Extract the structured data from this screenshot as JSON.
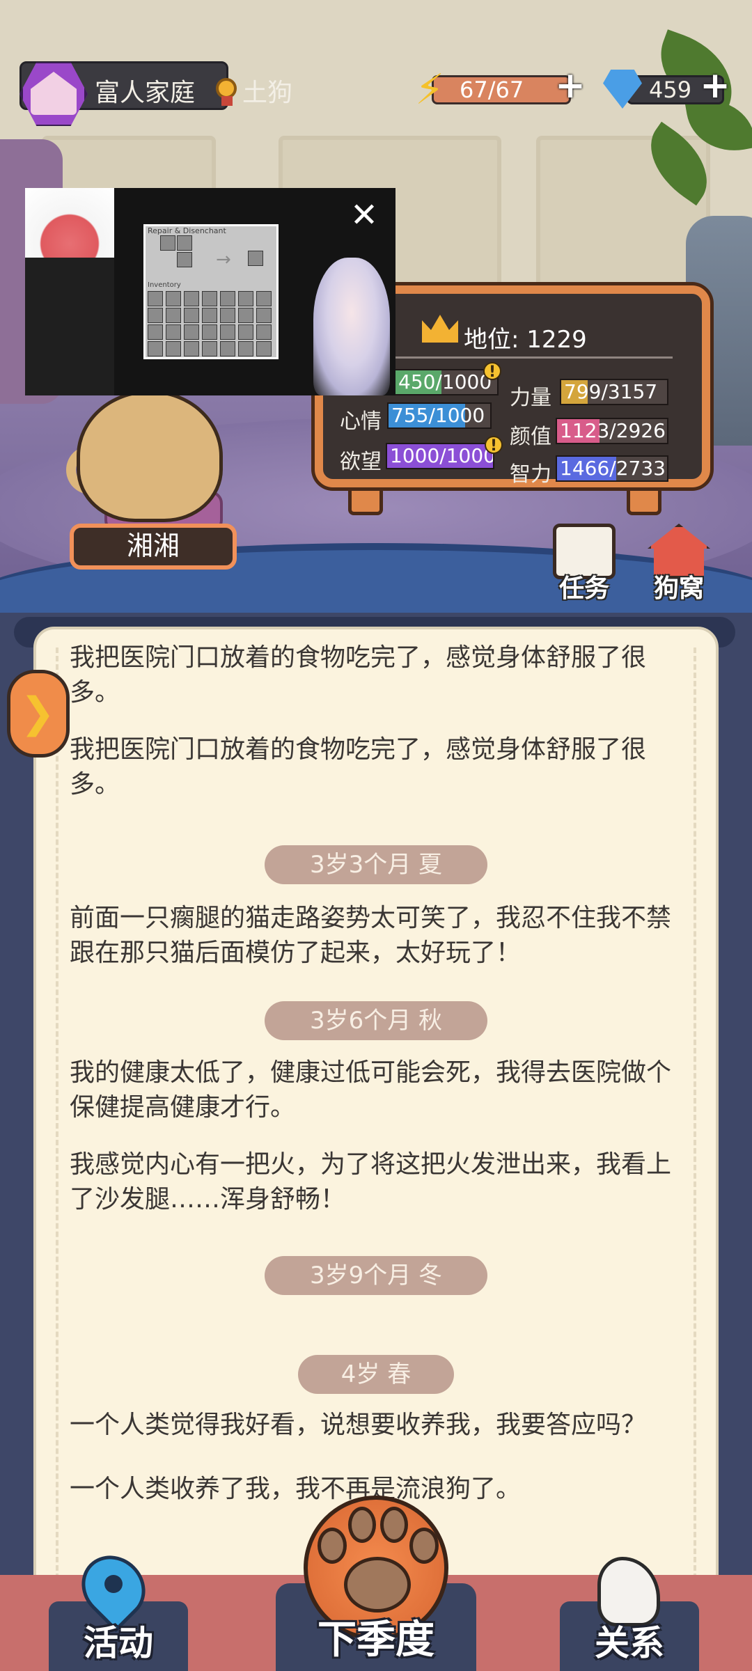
{
  "top_bar": {
    "home_label": "富人家庭",
    "rank_label": "土狗",
    "energy": "67/67",
    "gems": "459",
    "plus": "+"
  },
  "pet": {
    "name": "湘湘"
  },
  "status_board": {
    "status_label": "地位: 1229",
    "stats": [
      {
        "label": "",
        "value": "450/1000",
        "fraction": 0.45,
        "color": "#5aa86a",
        "warn": "!"
      },
      {
        "label": "力量",
        "value": "799/3157",
        "fraction": 0.253,
        "color": "#d4a53c"
      },
      {
        "label": "心情",
        "value": "755/1000",
        "fraction": 0.755,
        "color": "#3c8fd6"
      },
      {
        "label": "颜值",
        "value": "1123/2926",
        "fraction": 0.384,
        "color": "#d85c8a"
      },
      {
        "label": "欲望",
        "value": "1000/1000",
        "fraction": 1.0,
        "color": "#8b4fd6",
        "warn": "!"
      },
      {
        "label": "智力",
        "value": "1466/2733",
        "fraction": 0.536,
        "color": "#5a6ae0"
      }
    ]
  },
  "overlay": {
    "close": "✕",
    "mc_title": "Repair & Disenchant",
    "mc_inventory": "Inventory"
  },
  "side_buttons": {
    "tasks": "任务",
    "kennel": "狗窝"
  },
  "journal": {
    "entries": [
      {
        "type": "text",
        "text": "我把医院门口放着的食物吃完了，感觉身体舒服了很多。"
      },
      {
        "type": "text",
        "text": "我把医院门口放着的食物吃完了，感觉身体舒服了很多。"
      },
      {
        "type": "season",
        "text": "3岁3个月 夏"
      },
      {
        "type": "text",
        "text": "前面一只瘸腿的猫走路姿势太可笑了，我忍不住我不禁跟在那只猫后面模仿了起来，太好玩了！"
      },
      {
        "type": "season",
        "text": "3岁6个月 秋"
      },
      {
        "type": "text",
        "text": "我的健康太低了，健康过低可能会死，我得去医院做个保健提高健康才行。"
      },
      {
        "type": "text",
        "text": "我感觉内心有一把火，为了将这把火发泄出来，我看上了沙发腿……浑身舒畅！"
      },
      {
        "type": "season",
        "text": "3岁9个月 冬"
      },
      {
        "type": "season",
        "text": "4岁 春"
      },
      {
        "type": "text",
        "text": "一个人类觉得我好看，说想要收养我，我要答应吗？"
      },
      {
        "type": "text",
        "text": "一个人类收养了我，我不再是流浪狗了。"
      }
    ]
  },
  "bottom_nav": {
    "activities": "活动",
    "next_season": "下季度",
    "relations": "关系"
  }
}
